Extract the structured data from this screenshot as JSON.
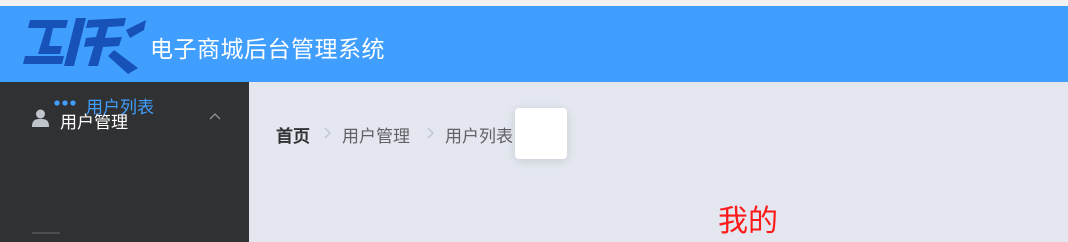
{
  "header": {
    "logo_text": "互联",
    "app_title": "电子商城后台管理系统"
  },
  "sidebar": {
    "menu": {
      "label": "用户管理",
      "icon": "user-icon",
      "expanded": true
    },
    "submenu": [
      {
        "label": "用户列表",
        "icon": "dots-icon",
        "active": true
      }
    ]
  },
  "breadcrumb": {
    "items": [
      "首页",
      "用户管理",
      "用户列表"
    ]
  },
  "main": {
    "content_text": "我的"
  },
  "colors": {
    "header_bg": "#409eff",
    "sidebar_bg": "#303133",
    "main_bg": "#e4e7ef",
    "active_text": "#409eff",
    "highlight_text": "#ff1a1a"
  }
}
